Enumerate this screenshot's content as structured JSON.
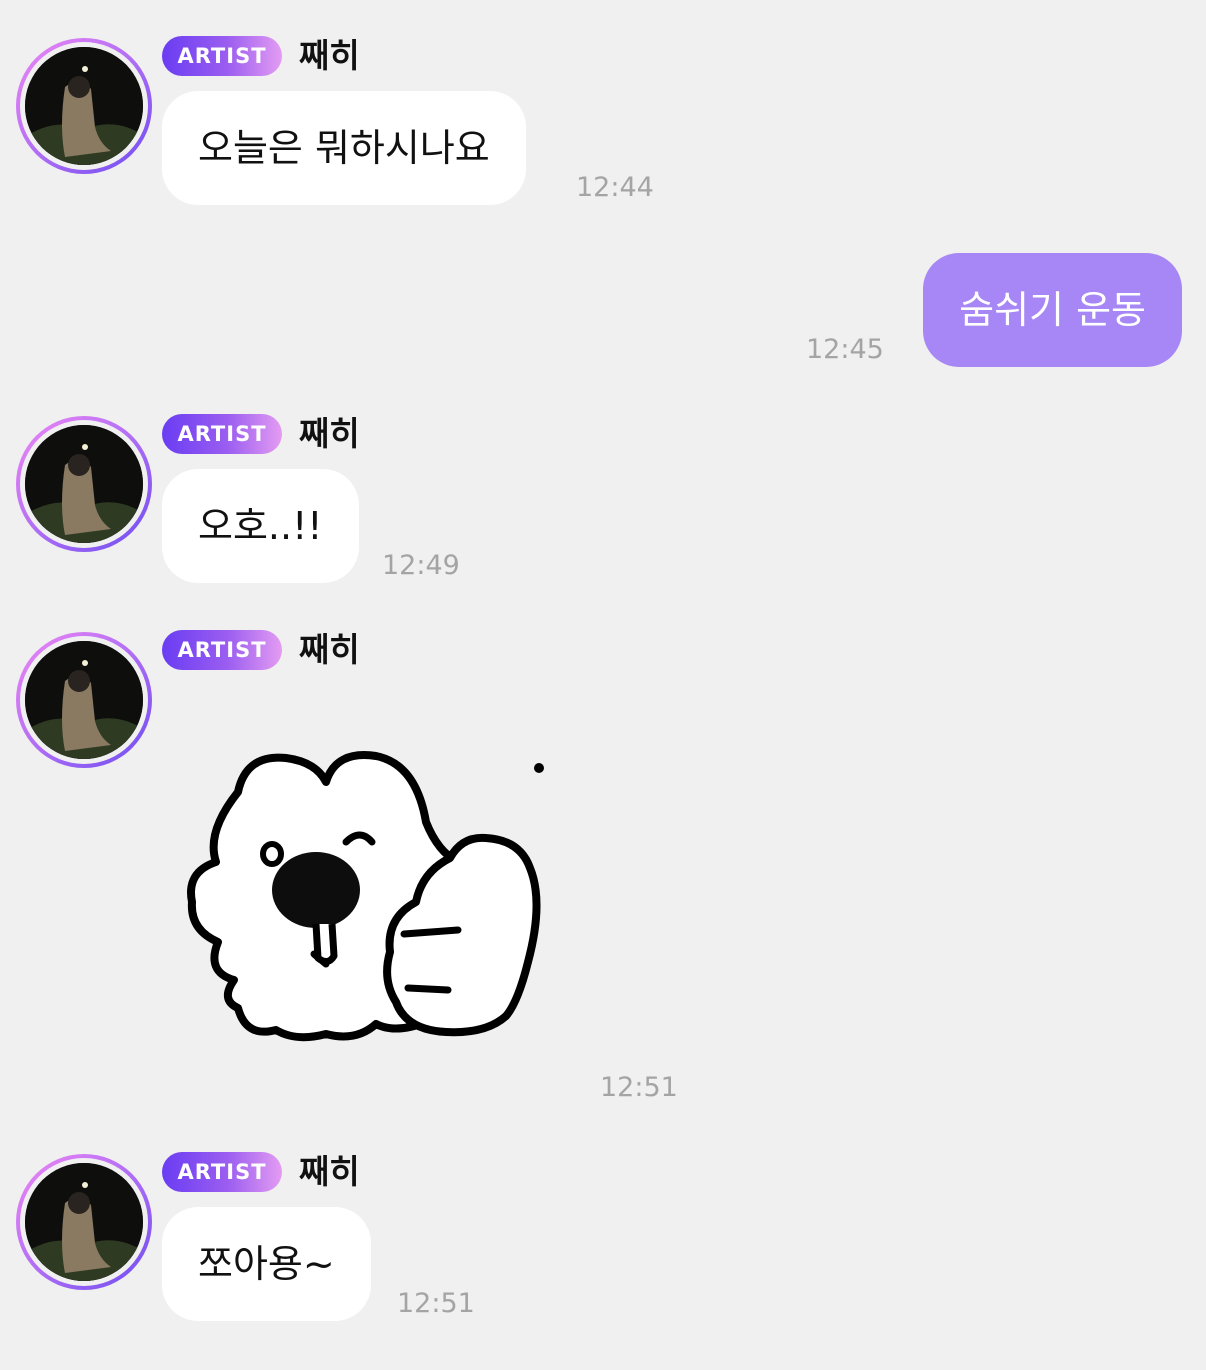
{
  "artist_badge": "ARTIST",
  "sender_name": "째히",
  "messages": [
    {
      "text": "오늘은 뭐하시나요",
      "time": "12:44"
    },
    {
      "text": "숨쉬기 운동",
      "time": "12:45"
    },
    {
      "text": "오호..!!",
      "time": "12:49"
    },
    {
      "sticker": "thumbs-up-creature-sticker",
      "time": "12:51"
    },
    {
      "text": "쪼아용~",
      "time": "12:51"
    }
  ],
  "colors": {
    "background": "#f0f0f0",
    "incoming_bubble": "#ffffff",
    "outgoing_bubble": "#a687f5",
    "badge_start": "#6a3df2",
    "badge_end": "#e49cf2",
    "timestamp": "#a4a4a4"
  }
}
